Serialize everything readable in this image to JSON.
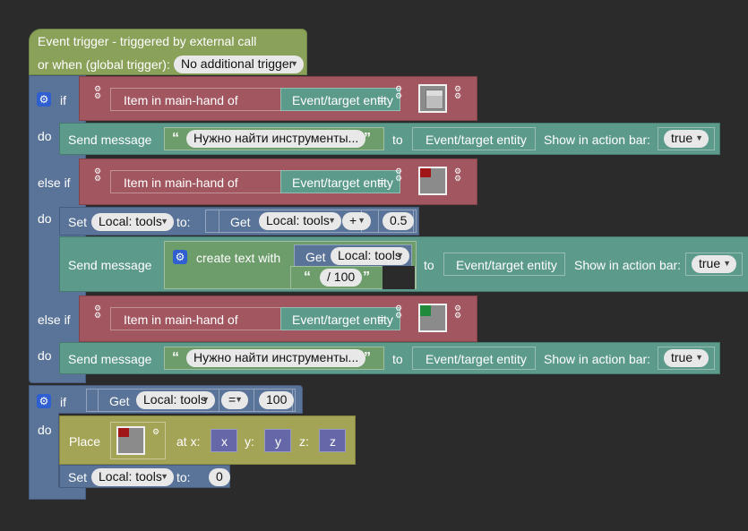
{
  "trigger": {
    "title": "Event trigger - triggered by external call",
    "global_label": "or when (global trigger):",
    "global_value": "No additional trigger"
  },
  "keywords": {
    "if": "if",
    "do": "do",
    "else_if": "else if",
    "send_message": "Send message",
    "to": "to",
    "show_in_action_bar": "Show in action bar:",
    "item_in_main_hand": "Item in main-hand of",
    "event_target": "Event/target entity",
    "set": "Set",
    "to_colon": "to:",
    "get": "Get",
    "create_text_with": "create text with",
    "place": "Place",
    "at_x": "at x:",
    "y": "y:",
    "z": "z:"
  },
  "values": {
    "true": "true",
    "equals": "=",
    "plus": "+",
    "local_tools": "Local: tools",
    "num_05": "0.5",
    "num_100": "100",
    "num_0": "0",
    "message_text": "Нужно найти инструменты...",
    "slash_100": "/ 100",
    "x": "x",
    "y": "y",
    "z": "z"
  }
}
